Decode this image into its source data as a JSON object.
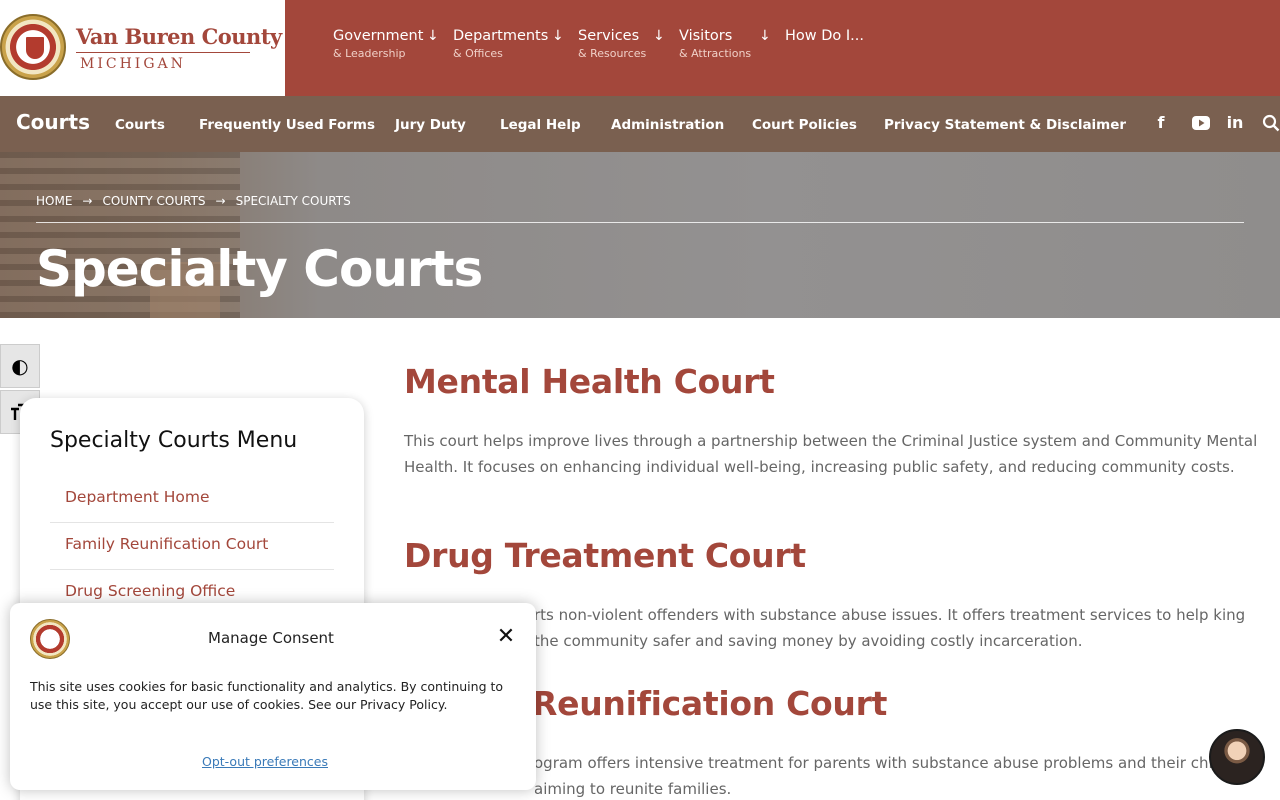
{
  "header": {
    "county_name": "Van Buren County",
    "county_state": "MICHIGAN",
    "nav": [
      {
        "label": "Government",
        "sub": "& Leadership"
      },
      {
        "label": "Departments",
        "sub": "& Offices"
      },
      {
        "label": "Services",
        "sub": "& Resources"
      },
      {
        "label": "Visitors",
        "sub": "& Attractions"
      },
      {
        "label": "How Do I...",
        "sub": ""
      }
    ],
    "arrow": "↓"
  },
  "subnav": {
    "brand": "Courts",
    "items": [
      "Courts",
      "Frequently Used Forms",
      "Jury Duty",
      "Legal Help",
      "Administration",
      "Court Policies",
      "Privacy Statement & Disclaimer"
    ],
    "social": {
      "facebook": "f",
      "linkedin": "in"
    }
  },
  "hero": {
    "breadcrumb": [
      "HOME",
      "COUNTY COURTS",
      "SPECIALTY COURTS"
    ],
    "breadcrumb_sep": "→",
    "title": "Specialty Courts"
  },
  "sidebar": {
    "title": "Specialty Courts Menu",
    "items": [
      "Department Home",
      "Family Reunification Court",
      "Drug Screening Office"
    ]
  },
  "content": {
    "sections": [
      {
        "title": "Mental Health Court",
        "text": "This court helps improve lives through a partnership between the Criminal Justice system and Community Mental Health. It focuses on enhancing individual well-being, increasing public safety, and reducing community costs."
      },
      {
        "title": "Drug Treatment Court",
        "text": "rts non-violent offenders with substance abuse issues. It offers treatment services to help king the community safer and saving money by avoiding costly incarceration."
      },
      {
        "title": "Reunification Court",
        "text": "ogram offers intensive treatment for parents with substance abuse problems and their children, aiming to reunite families."
      }
    ]
  },
  "consent": {
    "title": "Manage Consent",
    "close": "✕",
    "text": "This site uses cookies for basic functionality and analytics. By continuing to use this site, you accept our use of cookies. See our Privacy Policy.",
    "link": "Opt-out preferences"
  },
  "a11y": {
    "contrast_icon": "◐",
    "font_icon": "ᴛT"
  },
  "colors": {
    "brand": "#a3473b",
    "subnav": "#7a6050",
    "link": "#3a7ab8"
  }
}
